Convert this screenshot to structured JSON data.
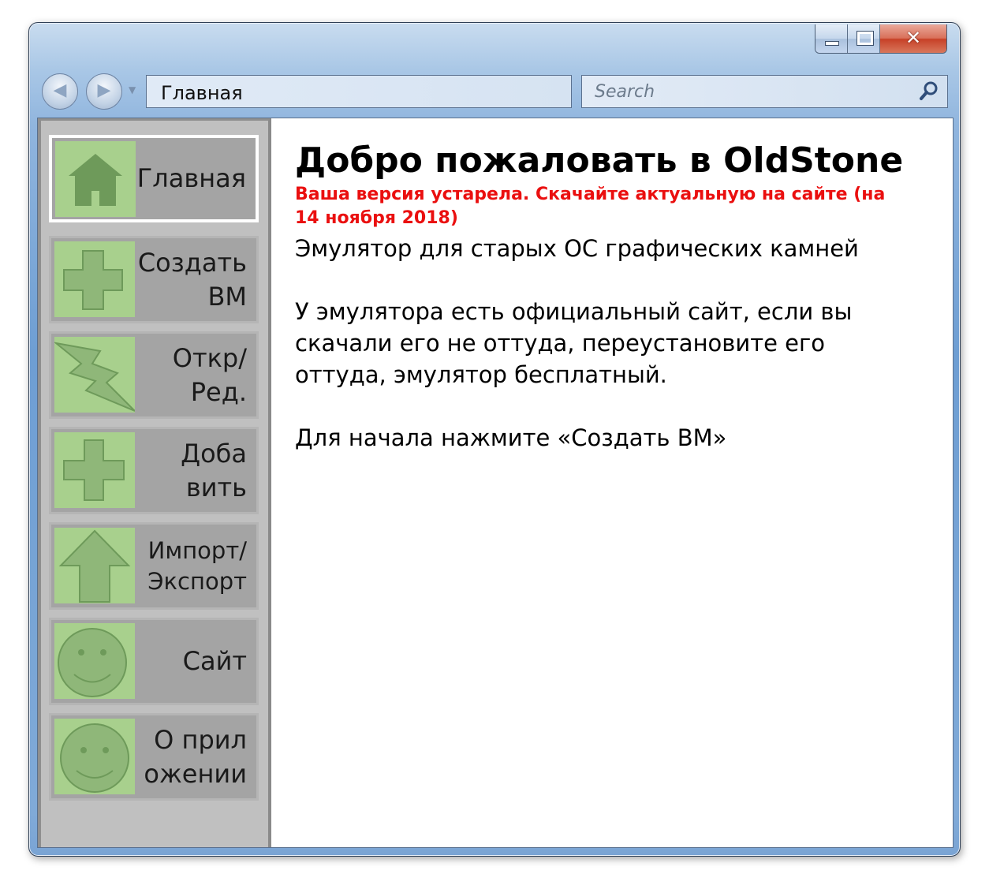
{
  "window": {
    "buttons": {
      "minimize": "minimize",
      "maximize": "maximize",
      "close": "✕"
    }
  },
  "toolbar": {
    "address": "Главная",
    "search_placeholder": "Search"
  },
  "sidebar": {
    "items": [
      {
        "label": "Главная",
        "icon": "home-icon",
        "selected": true
      },
      {
        "label": "Создать\nВМ",
        "icon": "plus-icon"
      },
      {
        "label": "Откр/\nРед.",
        "icon": "lightning-icon"
      },
      {
        "label": "Доба\nвить",
        "icon": "plus-icon"
      },
      {
        "label": "Импорт/\nЭкспорт",
        "icon": "up-arrow-icon"
      },
      {
        "label": "Сайт",
        "icon": "smiley-icon"
      },
      {
        "label": "О прил\nожении",
        "icon": "smiley-icon"
      }
    ]
  },
  "main": {
    "title": "Добро пожаловать в OldStone",
    "warning": "Ваша версия устарела. Скачайте актуальную на сайте (на 14 ноября 2018)",
    "description": "Эмулятор для старых ОС графических камней",
    "paragraph1": "У эмулятора есть официальный сайт, если вы скачали его не оттуда, переустановите его оттуда, эмулятор бесплатный.",
    "paragraph2": "Для начала нажмите «Создать ВМ»"
  },
  "colors": {
    "tile_green": "#a8d08d",
    "icon_green": "#6e9a5a",
    "warning_red": "#ea0f0f",
    "sidebar_gray": "#c0c0c0"
  }
}
